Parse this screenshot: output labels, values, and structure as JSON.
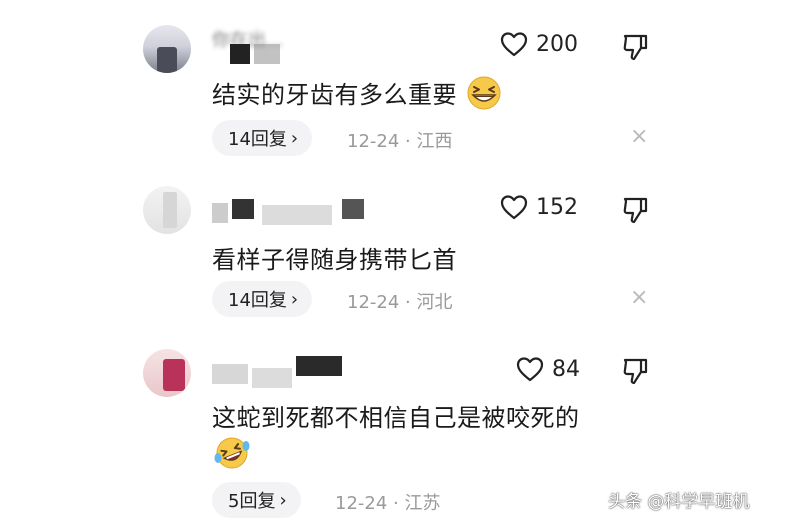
{
  "comments": [
    {
      "name": "你在出...",
      "likes": "200",
      "text": "结实的牙齿有多么重要",
      "emoji": "grinning-squint-face",
      "reply_label": "14回复",
      "reply_chevron": "›",
      "date": "12-24",
      "separator": "·",
      "location": "江西",
      "close": "×"
    },
    {
      "name": "",
      "likes": "152",
      "text": "看样子得随身携带匕首",
      "reply_label": "14回复",
      "reply_chevron": "›",
      "date": "12-24",
      "separator": "·",
      "location": "河北",
      "close": "×"
    },
    {
      "name": "",
      "likes": "84",
      "text": "这蛇到死都不相信自己是被咬死的",
      "emoji": "rolling-on-floor-laughing",
      "reply_label": "5回复",
      "reply_chevron": "›",
      "date": "12-24",
      "separator": "·",
      "location": "江苏"
    }
  ],
  "watermark": "头条 @科学早班机",
  "colors": {
    "text": "#1a1a1a",
    "meta": "#9a9a9a",
    "pill": "#f3f3f5"
  }
}
